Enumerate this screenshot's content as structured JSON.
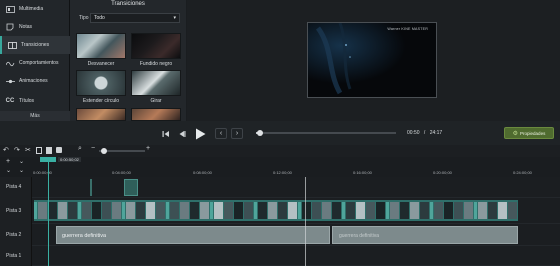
{
  "sidebar": {
    "items": [
      {
        "label": "Multimedia",
        "icon": "media-icon"
      },
      {
        "label": "Notas",
        "icon": "notes-icon"
      },
      {
        "label": "Transiciones",
        "icon": "transitions-icon",
        "active": true
      },
      {
        "label": "Comportamientos",
        "icon": "behaviors-icon"
      },
      {
        "label": "Animaciones",
        "icon": "animations-icon"
      },
      {
        "label": "Títulos",
        "icon": "titles-icon"
      }
    ],
    "more_label": "Más"
  },
  "transitions_panel": {
    "title": "Transiciones",
    "filter_label": "Tipo",
    "filter_value": "Todo",
    "items": [
      {
        "label": "Desvanecer"
      },
      {
        "label": "Fundido negro"
      },
      {
        "label": "Estender círculo"
      },
      {
        "label": "Girar"
      },
      {
        "label": ""
      },
      {
        "label": ""
      }
    ]
  },
  "preview": {
    "overlay_text": "Warner KINE MASTER"
  },
  "playback": {
    "timecode_current": "00:50",
    "timecode_separator": "/",
    "timecode_total": "24:17",
    "progress_fraction": 0.03,
    "properties_label": "Propiedades"
  },
  "timeline": {
    "playhead_time": "0:00:50;02",
    "ruler_labels": [
      "0:00:00;00",
      "0:04:00;00",
      "0:08:00;00",
      "0:12:00;00",
      "0:16:00;00",
      "0:20:00;00",
      "0:24:00;00"
    ],
    "tracks": [
      {
        "label": "Pista 4"
      },
      {
        "label": "Pista 3"
      },
      {
        "label": "Pista 2",
        "clips": [
          "guerrera definitiva",
          "guerrera definitiva"
        ]
      },
      {
        "label": "Pista 1"
      }
    ]
  },
  "colors": {
    "accent": "#3ab0a3",
    "properties_button": "#4f6b2f",
    "audio_clip": "#7d8a8c",
    "video_clip": "#2f6f6a"
  }
}
